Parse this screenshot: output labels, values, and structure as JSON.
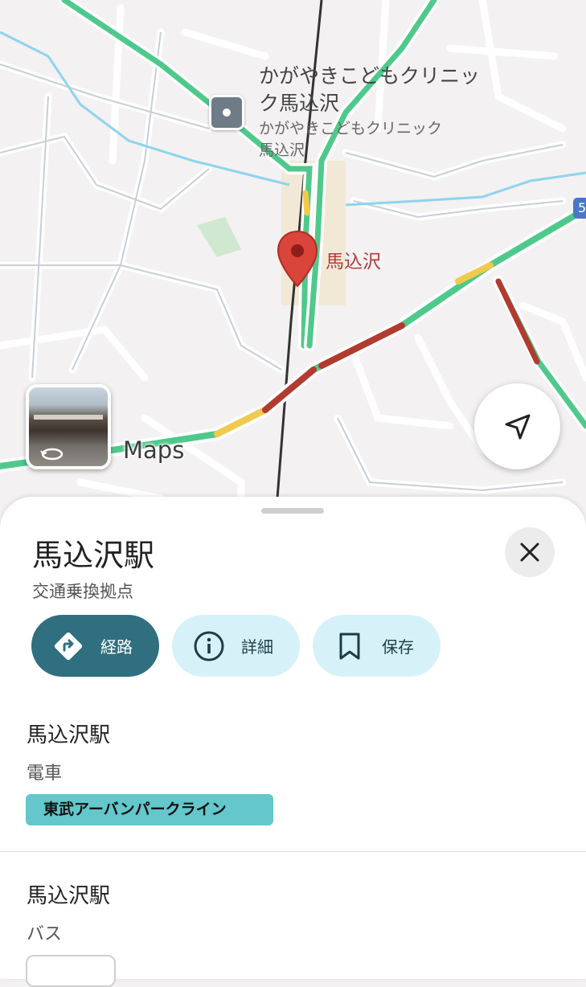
{
  "map": {
    "poi_name_large": "かがやきこどもクリニック馬込沢",
    "poi_name_small": "かがやきこどもクリニック馬込沢",
    "station_label": "馬込沢",
    "route_number": "5",
    "brand_text": "Maps",
    "colors": {
      "traffic_green": "#4fc98b",
      "traffic_yellow": "#f2c94c",
      "traffic_red": "#b33a2f",
      "pin": "#d9443b"
    },
    "icons": {
      "poi": "building-icon",
      "pin": "location-pin-icon",
      "street_view": "street-view-rotate-icon",
      "locate": "navigation-arrow-icon"
    }
  },
  "sheet": {
    "title": "馬込沢駅",
    "subtitle": "交通乗換拠点",
    "close_icon": "close-icon",
    "actions": [
      {
        "label": "経路",
        "icon": "directions-icon"
      },
      {
        "label": "詳細",
        "icon": "info-icon"
      },
      {
        "label": "保存",
        "icon": "bookmark-icon"
      }
    ],
    "sections": [
      {
        "title": "馬込沢駅",
        "mode": "電車",
        "line": "東武アーバンパークライン",
        "line_color": "#63c7cb"
      },
      {
        "title": "馬込沢駅",
        "mode": "バス"
      }
    ],
    "colors": {
      "primary_button": "#2f6f80",
      "secondary_button": "#d6f2f8"
    }
  }
}
